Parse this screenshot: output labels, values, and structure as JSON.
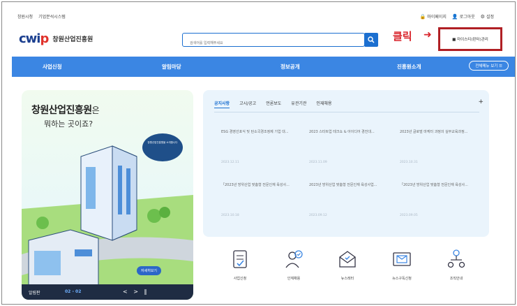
{
  "util": {
    "left_links": [
      "창원시청",
      "기업분석시스템"
    ],
    "right_links": [
      "마이페이지",
      "로그아웃",
      "설정"
    ]
  },
  "header": {
    "logo_mark": "cwip",
    "logo_text": "창원산업진흥원",
    "search_placeholder": "검색어를 입력해주세요",
    "click_label": "클릭",
    "manage_button": "■ 마이스티(판터)관리"
  },
  "nav": {
    "items": [
      "사업신청",
      "알림마당",
      "정보공개",
      "진흥원소개"
    ],
    "all_menu": "전체메뉴 보기"
  },
  "hero": {
    "title_main": "창원산업진흥원",
    "title_suffix": "은",
    "subtitle": "뭐하는 곳이죠?",
    "bubble": "창원산업진흥원을 소개합니다",
    "more_button": "자세히보기",
    "control_label": "알림판",
    "page": "02 - 02",
    "arrows": "< > ‖"
  },
  "notice": {
    "tabs": [
      "공지사항",
      "고시/공고",
      "언론보도",
      "유관기관",
      "인재채용"
    ],
    "active_tab": 0,
    "plus": "+",
    "posts": [
      {
        "title": "ESG 경영선포식 및 탄소국경조정제 기업 대...",
        "date": "2023.12.11"
      },
      {
        "title": "2023 스타트업 테크쇼 & 아이디어 경진대...",
        "date": "2023.11.09"
      },
      {
        "title": "2023년 글로벌 마케터 과정의 실무교육과정...",
        "date": "2023.10.31"
      },
      {
        "title": "「2023년 방위산업 맞춤형 전문인재 육성사...",
        "date": "2023.10.18"
      },
      {
        "title": "2023년 방위산업 맞춤형 전문인재 육성사업...",
        "date": "2023.09.12"
      },
      {
        "title": "「2023년 방위산업 맞춤형 전문인재 육성사...",
        "date": "2023.09.05"
      }
    ]
  },
  "quick_links": [
    {
      "label": "사업신청",
      "icon": "document-edit-icon"
    },
    {
      "label": "인재채용",
      "icon": "user-check-icon"
    },
    {
      "label": "뉴스레터",
      "icon": "newsletter-icon"
    },
    {
      "label": "뉴스구독신청",
      "icon": "mail-subscribe-icon"
    },
    {
      "label": "조직안내",
      "icon": "org-chart-icon"
    }
  ],
  "colors": {
    "nav_blue": "#3b86e3",
    "accent_red": "#d8232a",
    "logo_navy": "#1b3f8f"
  }
}
